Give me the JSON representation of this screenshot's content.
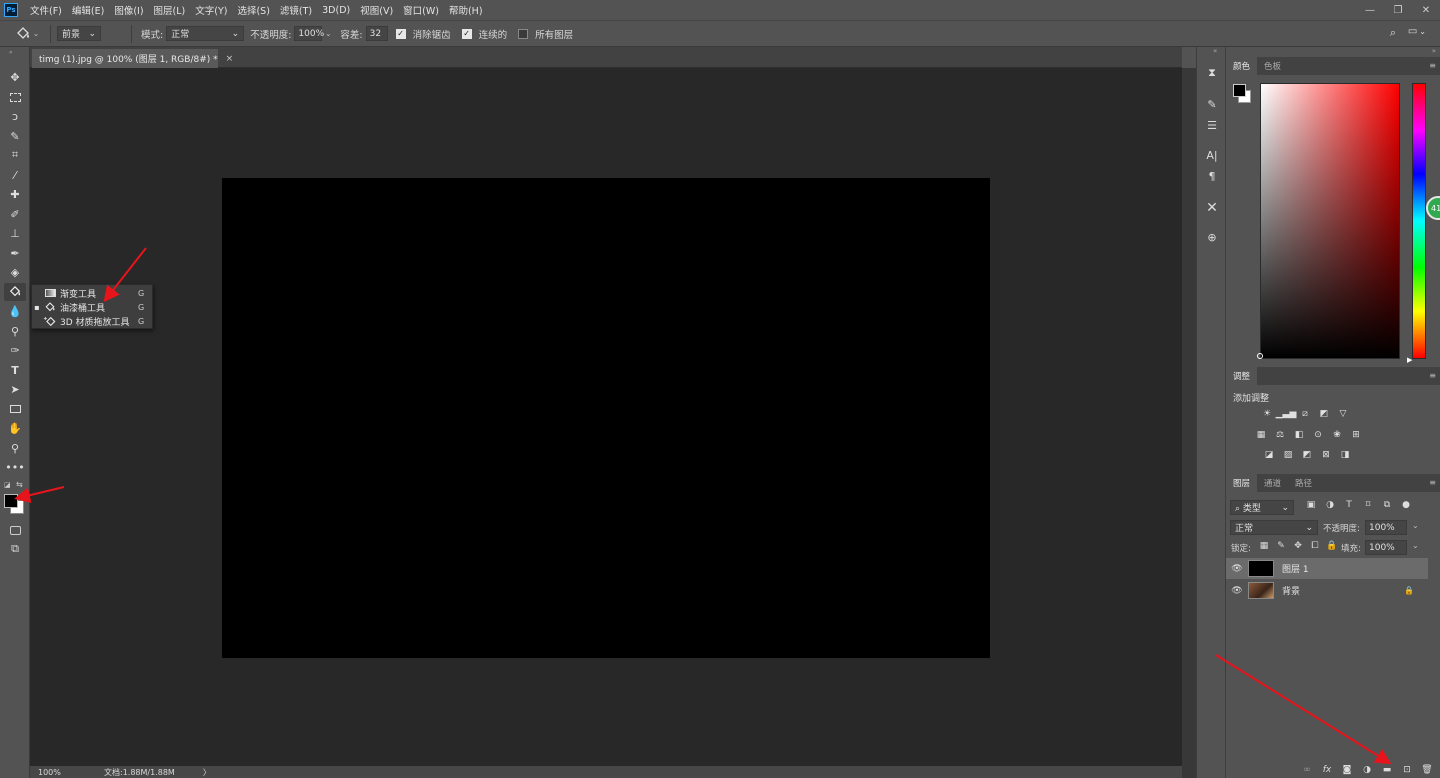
{
  "app": {
    "logo": "Ps"
  },
  "menu": [
    "文件(F)",
    "编辑(E)",
    "图像(I)",
    "图层(L)",
    "文字(Y)",
    "选择(S)",
    "滤镜(T)",
    "3D(D)",
    "视图(V)",
    "窗口(W)",
    "帮助(H)"
  ],
  "window_controls": {
    "minimize": "—",
    "restore": "❐",
    "close": "✕"
  },
  "options": {
    "fill_source": "前景",
    "mode_label": "模式:",
    "mode_value": "正常",
    "opacity_label": "不透明度:",
    "opacity_value": "100%",
    "tolerance_label": "容差:",
    "tolerance_value": "32",
    "antialias_label": "消除锯齿",
    "antialias_checked": true,
    "contiguous_label": "连续的",
    "contiguous_checked": true,
    "all_layers_label": "所有图层",
    "all_layers_checked": false
  },
  "document": {
    "tab_title": "timg (1).jpg @ 100% (图层 1, RGB/8#) *",
    "close": "×",
    "canvas_color": "#000000"
  },
  "status": {
    "zoom": "100%",
    "doc_info": "文档:1.88M/1.88M",
    "arrow": "〉"
  },
  "flyout": [
    {
      "label": "渐变工具",
      "key": "G",
      "icon": "gradient-icon",
      "selected": false
    },
    {
      "label": "油漆桶工具",
      "key": "G",
      "icon": "paint-bucket-icon",
      "selected": true
    },
    {
      "label": "3D 材质拖放工具",
      "key": "G",
      "icon": "3d-material-drop-icon",
      "selected": false
    }
  ],
  "color_panel": {
    "tabs": [
      "颜色",
      "色板"
    ],
    "foreground": "#000000",
    "background": "#ffffff",
    "hue_color": "#ff0000",
    "badge": "41"
  },
  "adjustments_panel": {
    "tab": "调整",
    "add_label": "添加调整"
  },
  "layers_panel": {
    "tabs": [
      "图层",
      "通道",
      "路径"
    ],
    "filter_label": "类型",
    "blend_mode": "正常",
    "opacity_label": "不透明度:",
    "opacity_value": "100%",
    "lock_label": "锁定:",
    "fill_label": "填充:",
    "fill_value": "100%",
    "layers": [
      {
        "name": "图层 1",
        "selected": true,
        "locked": false
      },
      {
        "name": "背景",
        "selected": false,
        "locked": true
      }
    ],
    "bottom_icons": [
      "link-icon",
      "fx-icon",
      "mask-icon",
      "adjustment-layer-icon",
      "group-icon",
      "new-layer-icon",
      "delete-icon"
    ],
    "fx_label": "fx"
  },
  "annotation_color": "#e8141c"
}
